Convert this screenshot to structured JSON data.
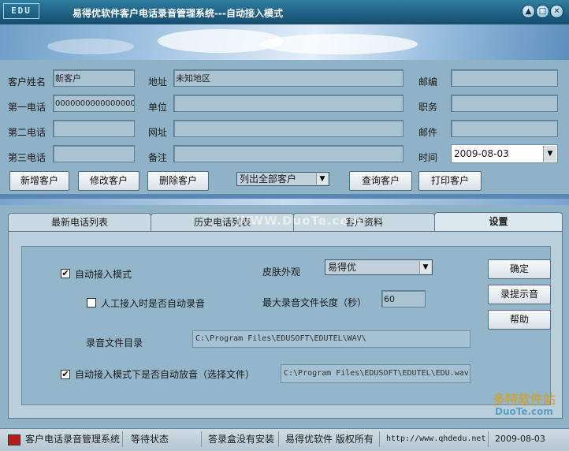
{
  "window": {
    "logo": "EDU",
    "title": "易得优软件客户电话录音管理系统---自动接入模式",
    "controls": {
      "minimize": "▲",
      "maximize": "□",
      "close": "✕"
    }
  },
  "form": {
    "labels": {
      "customer_name": "客户姓名",
      "phone1": "第一电话",
      "phone2": "第二电话",
      "phone3": "第三电话",
      "address": "地址",
      "company": "单位",
      "website": "网址",
      "note": "备注",
      "zip": "邮编",
      "position": "职务",
      "email": "邮件",
      "time": "时间"
    },
    "values": {
      "customer_name": "新客户",
      "phone1": "0000000000000000",
      "phone2": "",
      "phone3": "",
      "address": "未知地区",
      "company": "",
      "website": "",
      "note": "",
      "zip": "",
      "position": "",
      "email": "",
      "time": "2009-08-03"
    }
  },
  "actions": {
    "new_customer": "新增客户",
    "edit_customer": "修改客户",
    "delete_customer": "删除客户",
    "list_filter": "列出全部客户",
    "query_customer": "查询客户",
    "print_customer": "打印客户"
  },
  "tabs": [
    "最新电话列表",
    "历史电话列表",
    "客户资料",
    "设置"
  ],
  "active_tab": "设置",
  "settings": {
    "auto_mode_label": "自动接入模式",
    "auto_mode_checked": true,
    "manual_record_label": "人工接入时是否自动录音",
    "manual_record_checked": false,
    "skin_label": "皮肤外观",
    "skin_value": "易得优",
    "max_len_label": "最大录音文件长度（秒）",
    "max_len_value": "60",
    "record_dir_label": "录音文件目录",
    "record_dir_value": "C:\\Program Files\\EDUSOFT\\EDUTEL\\WAV\\",
    "auto_play_label": "自动接入模式下是否自动放音（选择文件）",
    "auto_play_checked": true,
    "auto_play_file": "C:\\Program Files\\EDUSOFT\\EDUTEL\\EDU.wav",
    "buttons": {
      "ok": "确定",
      "record_prompt": "录提示音",
      "help": "帮助"
    }
  },
  "status": {
    "app": "客户电话录音管理系统",
    "state": "等待状态",
    "device": "答录盒没有安装",
    "copyright": "易得优软件 版权所有",
    "url": "http://www.qhdedu.net",
    "date": "2009-08-03"
  },
  "watermark": {
    "center": "WWW.DuoTe.com",
    "corner_cn": "多特软件站",
    "corner_en": "DuoTe.com"
  }
}
